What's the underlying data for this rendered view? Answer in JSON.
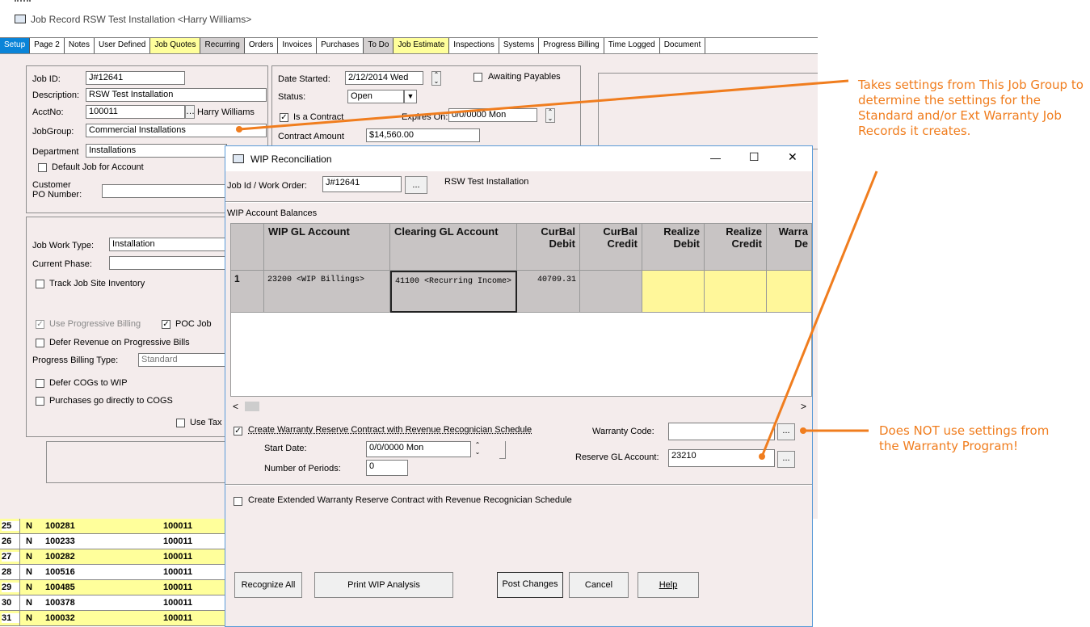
{
  "window": {
    "title": "Job Record RSW Test Installation <Harry Williams>"
  },
  "tabs": [
    {
      "label": "Setup",
      "active": true
    },
    {
      "label": "Page 2"
    },
    {
      "label": "Notes"
    },
    {
      "label": "User Defined"
    },
    {
      "label": "Job Quotes"
    },
    {
      "label": "Recurring"
    },
    {
      "label": "Orders"
    },
    {
      "label": "Invoices"
    },
    {
      "label": "Purchases"
    },
    {
      "label": "To Do"
    },
    {
      "label": "Job Estimate"
    },
    {
      "label": "Inspections"
    },
    {
      "label": "Systems"
    },
    {
      "label": "Progress Billing"
    },
    {
      "label": "Time Logged"
    },
    {
      "label": "Document"
    }
  ],
  "job": {
    "job_id_label": "Job ID:",
    "job_id": "J#12641",
    "description_label": "Description:",
    "description": "RSW Test Installation",
    "acctno_label": "AcctNo:",
    "acctno": "100011",
    "acct_name": "Harry Williams",
    "jobgroup_label": "JobGroup:",
    "jobgroup": "Commercial Installations",
    "department_label": "Department",
    "department": "Installations",
    "default_job_label": "Default Job for Account",
    "customer_po_label": "Customer PO Number:",
    "date_started_label": "Date Started:",
    "date_started": "2/12/2014 Wed",
    "awaiting_payables_label": "Awaiting Payables",
    "status_label": "Status:",
    "status": "Open",
    "is_contract_label": "Is a Contract",
    "expires_on_label": "Expires On:",
    "expires_on": "0/0/0000 Mon",
    "contract_amount_label": "Contract Amount",
    "contract_amount": "$14,560.00",
    "job_work_type_label": "Job Work Type:",
    "job_work_type": "Installation",
    "current_phase_label": "Current Phase:",
    "track_inventory_label": "Track Job Site Inventory",
    "use_progressive_label": "Use Progressive Billing",
    "poc_job_label": "POC Job",
    "defer_revenue_label": "Defer Revenue on Progressive Bills",
    "progress_billing_type_label": "Progress Billing Type:",
    "progress_billing_type": "Standard",
    "defer_cogs_label": "Defer COGs to WIP",
    "purchases_cogs_label": "Purchases go directly to COGS",
    "use_tax_label": "Use Tax"
  },
  "bottom_list": [
    {
      "num": "25",
      "flag": "N",
      "id": "100281",
      "acct": "100011",
      "highlight": true
    },
    {
      "num": "26",
      "flag": "N",
      "id": "100233",
      "acct": "100011",
      "highlight": false
    },
    {
      "num": "27",
      "flag": "N",
      "id": "100282",
      "acct": "100011",
      "highlight": true
    },
    {
      "num": "28",
      "flag": "N",
      "id": "100516",
      "acct": "100011",
      "highlight": false
    },
    {
      "num": "29",
      "flag": "N",
      "id": "100485",
      "acct": "100011",
      "highlight": true
    },
    {
      "num": "30",
      "flag": "N",
      "id": "100378",
      "acct": "100011",
      "highlight": false
    },
    {
      "num": "31",
      "flag": "N",
      "id": "100032",
      "acct": "100011",
      "highlight": true
    }
  ],
  "dialog": {
    "title": "WIP Reconciliation",
    "minimize": "—",
    "maximize": "☐",
    "close": "✕",
    "job_id_label": "Job Id / Work Order:",
    "job_id": "J#12641",
    "job_desc": "RSW Test Installation",
    "browse": "...",
    "balances_label": "WIP Account Balances",
    "columns": [
      {
        "l1": "WIP GL Account",
        "l2": ""
      },
      {
        "l1": "Clearing GL Account",
        "l2": ""
      },
      {
        "l1": "CurBal",
        "l2": "Debit"
      },
      {
        "l1": "CurBal",
        "l2": "Credit"
      },
      {
        "l1": "Realize",
        "l2": "Debit"
      },
      {
        "l1": "Realize",
        "l2": "Credit"
      },
      {
        "l1": "Warra",
        "l2": "De"
      }
    ],
    "row": {
      "num": "1",
      "wip": "23200 <WIP Billings>",
      "clearing": "41100 <Recurring Income>",
      "curbal_debit": "40709.31",
      "curbal_credit": "",
      "realize_debit": "",
      "realize_credit": "",
      "warranty": ""
    },
    "create_warranty_label": "Create Warranty Reserve Contract with Revenue Recognician Schedule",
    "start_date_label": "Start Date:",
    "start_date": "0/0/0000 Mon",
    "periods_label": "Number of Periods:",
    "periods": "0",
    "warranty_code_label": "Warranty Code:",
    "warranty_code": "",
    "reserve_gl_label": "Reserve GL Account:",
    "reserve_gl": "23210",
    "create_ext_label": "Create Extended Warranty Reserve Contract with Revenue Recognician Schedule",
    "buttons": {
      "recognize_all": "Recognize All",
      "print": "Print WIP Analysis",
      "post": "Post Changes",
      "cancel": "Cancel",
      "help": "Help"
    }
  },
  "callouts": {
    "top": "Takes settings from This Job Group to determine the settings for the Standard and/or Ext Warranty Job Records it creates.",
    "bottom": "Does NOT use settings from the Warranty Program!"
  },
  "colors": {
    "accent_orange": "#f07d1e",
    "tab_yellow": "#ffff9b",
    "setup_blue": "#0a84d8",
    "form_pink": "#f4ecec",
    "grid_gray": "#c8c4c4",
    "cell_yellow": "#fff79a"
  }
}
